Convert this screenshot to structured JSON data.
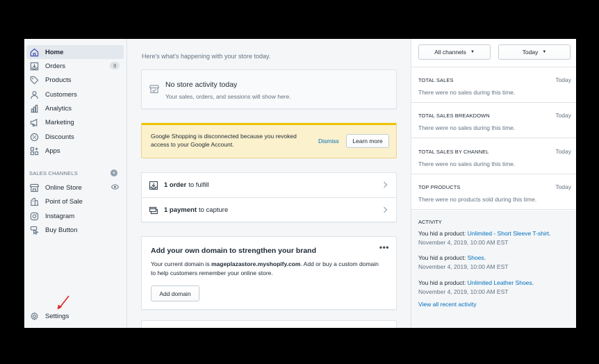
{
  "sidebar": {
    "items": [
      {
        "label": "Home",
        "icon": "home-icon"
      },
      {
        "label": "Orders",
        "icon": "orders-icon",
        "badge": "3"
      },
      {
        "label": "Products",
        "icon": "tag-icon"
      },
      {
        "label": "Customers",
        "icon": "person-icon"
      },
      {
        "label": "Analytics",
        "icon": "bar-chart-icon"
      },
      {
        "label": "Marketing",
        "icon": "megaphone-icon"
      },
      {
        "label": "Discounts",
        "icon": "discount-icon"
      },
      {
        "label": "Apps",
        "icon": "apps-icon"
      }
    ],
    "sales_channels_title": "SALES CHANNELS",
    "channels": [
      {
        "label": "Online Store",
        "icon": "store-icon"
      },
      {
        "label": "Point of Sale",
        "icon": "pos-icon"
      },
      {
        "label": "Instagram",
        "icon": "instagram-icon"
      },
      {
        "label": "Buy Button",
        "icon": "buy-button-icon"
      }
    ],
    "settings_label": "Settings"
  },
  "main": {
    "intro": "Here's what's happening with your store today.",
    "no_activity": {
      "title": "No store activity today",
      "subtitle": "Your sales, orders, and sessions will show here."
    },
    "banner": {
      "text": "Google Shopping is disconnected because you revoked access to your Google Account.",
      "dismiss": "Dismiss",
      "learn_more": "Learn more"
    },
    "tasks": [
      {
        "bold": "1 order",
        "rest": "to fulfill"
      },
      {
        "bold": "1 payment",
        "rest": "to capture"
      }
    ],
    "domain": {
      "title": "Add your own domain to strengthen your brand",
      "text_before": "Your current domain is ",
      "domain": "mageplazastore.myshopify.com",
      "text_after": ". Add or buy a custom domain to help customers remember your online store.",
      "button": "Add domain"
    }
  },
  "right": {
    "filter_channels": "All channels",
    "filter_date": "Today",
    "metrics": [
      {
        "title": "TOTAL SALES",
        "date": "Today",
        "message": "There were no sales during this time."
      },
      {
        "title": "TOTAL SALES BREAKDOWN",
        "date": "Today",
        "message": "There were no sales during this time."
      },
      {
        "title": "TOTAL SALES BY CHANNEL",
        "date": "Today",
        "message": "There were no sales during this time."
      },
      {
        "title": "TOP PRODUCTS",
        "date": "Today",
        "message": "There were no products sold during this time."
      }
    ],
    "activity": {
      "title": "ACTIVITY",
      "items": [
        {
          "prefix": "You hid a product: ",
          "product": "Unlimited - Short Sleeve T-shirt",
          "suffix": ".",
          "time": "November 4, 2019, 10:00 AM EST"
        },
        {
          "prefix": "You hid a product: ",
          "product": "Shoes",
          "suffix": ".",
          "time": "November 4, 2019, 10:00 AM EST"
        },
        {
          "prefix": "You hid a product: ",
          "product": "Unlimited Leather Shoes",
          "suffix": ".",
          "time": "November 4, 2019, 10:00 AM EST"
        }
      ],
      "view_all": "View all recent activity"
    }
  },
  "colors": {
    "accent": "#3f4eae",
    "link": "#006fbb",
    "banner": "#fcf1cd",
    "banner_border": "#eec200",
    "annotation_arrow": "#e02424"
  }
}
